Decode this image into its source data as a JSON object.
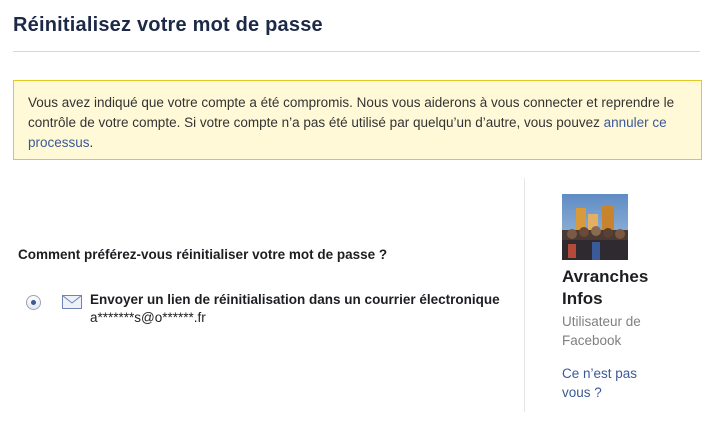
{
  "page": {
    "title": "Réinitialisez votre mot de passe"
  },
  "notice": {
    "text": "Vous avez indiqué que votre compte a été compromis. Nous vous aiderons à vous connecter et reprendre le contrôle de votre compte. Si votre compte n’a pas été utilisé par quelqu’un d’autre, vous pouvez ",
    "link": "annuler ce processus",
    "suffix": "."
  },
  "reset": {
    "question": "Comment préférez-vous réinitialiser votre mot de passe ?",
    "options": [
      {
        "icon": "mail-icon",
        "label": "Envoyer un lien de réinitialisation dans un courrier électronique",
        "value": "a*******s@o******.fr",
        "selected": true
      }
    ]
  },
  "user": {
    "name_line1": "Avranches",
    "name_line2": "Infos",
    "subtitle_line1": "Utilisateur de",
    "subtitle_line2": "Facebook",
    "not_you_line1": "Ce n’est pas",
    "not_you_line2": "vous ?"
  },
  "colors": {
    "link": "#3b5998",
    "notice_bg": "#fff9d7",
    "notice_border": "#e2c822"
  }
}
